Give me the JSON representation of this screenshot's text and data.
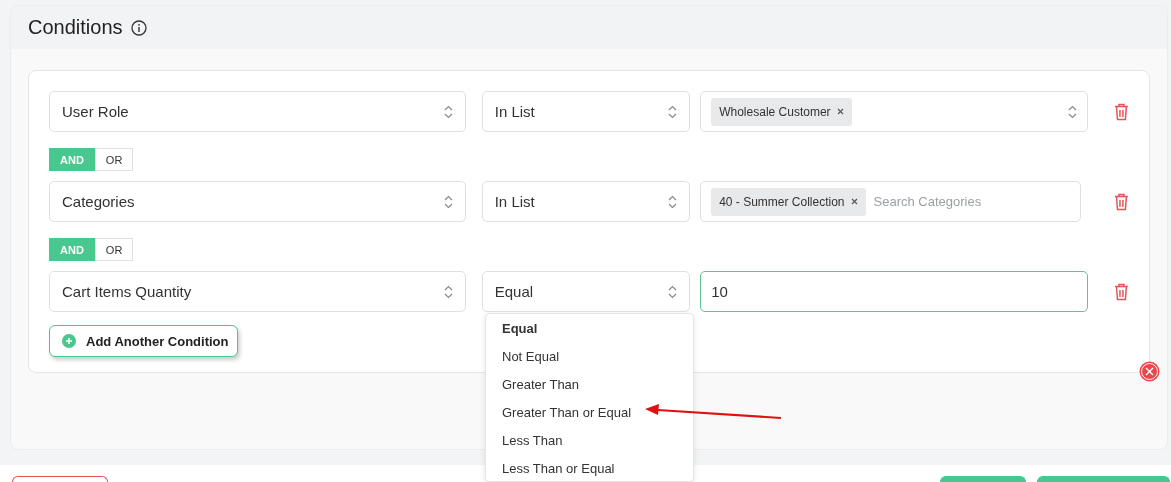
{
  "section": {
    "title": "Conditions"
  },
  "conditions": [
    {
      "field": "User Role",
      "operator": "In List",
      "value": {
        "kind": "tags",
        "tags": [
          "Wholesale Customer"
        ]
      },
      "connector": [
        {
          "label": "AND",
          "selected": true
        },
        {
          "label": "OR",
          "selected": false
        }
      ]
    },
    {
      "field": "Categories",
      "operator": "In List",
      "value": {
        "kind": "tags",
        "tags": [
          "40 - Summer Collection"
        ],
        "placeholder": "Search Categories"
      },
      "connector": [
        {
          "label": "AND",
          "selected": true
        },
        {
          "label": "OR",
          "selected": false
        }
      ]
    },
    {
      "field": "Cart Items Quantity",
      "operator": "Equal",
      "value": {
        "kind": "input",
        "text": "10",
        "focused": true
      }
    }
  ],
  "add_button": "Add Another Condition",
  "operator_menu": {
    "options": [
      {
        "label": "Equal",
        "selected": true
      },
      {
        "label": "Not Equal",
        "selected": false
      },
      {
        "label": "Greater Than",
        "selected": false
      },
      {
        "label": "Greater Than or Equal",
        "selected": false
      },
      {
        "label": "Less Than",
        "selected": false
      },
      {
        "label": "Less Than or Equal",
        "selected": false
      }
    ]
  }
}
